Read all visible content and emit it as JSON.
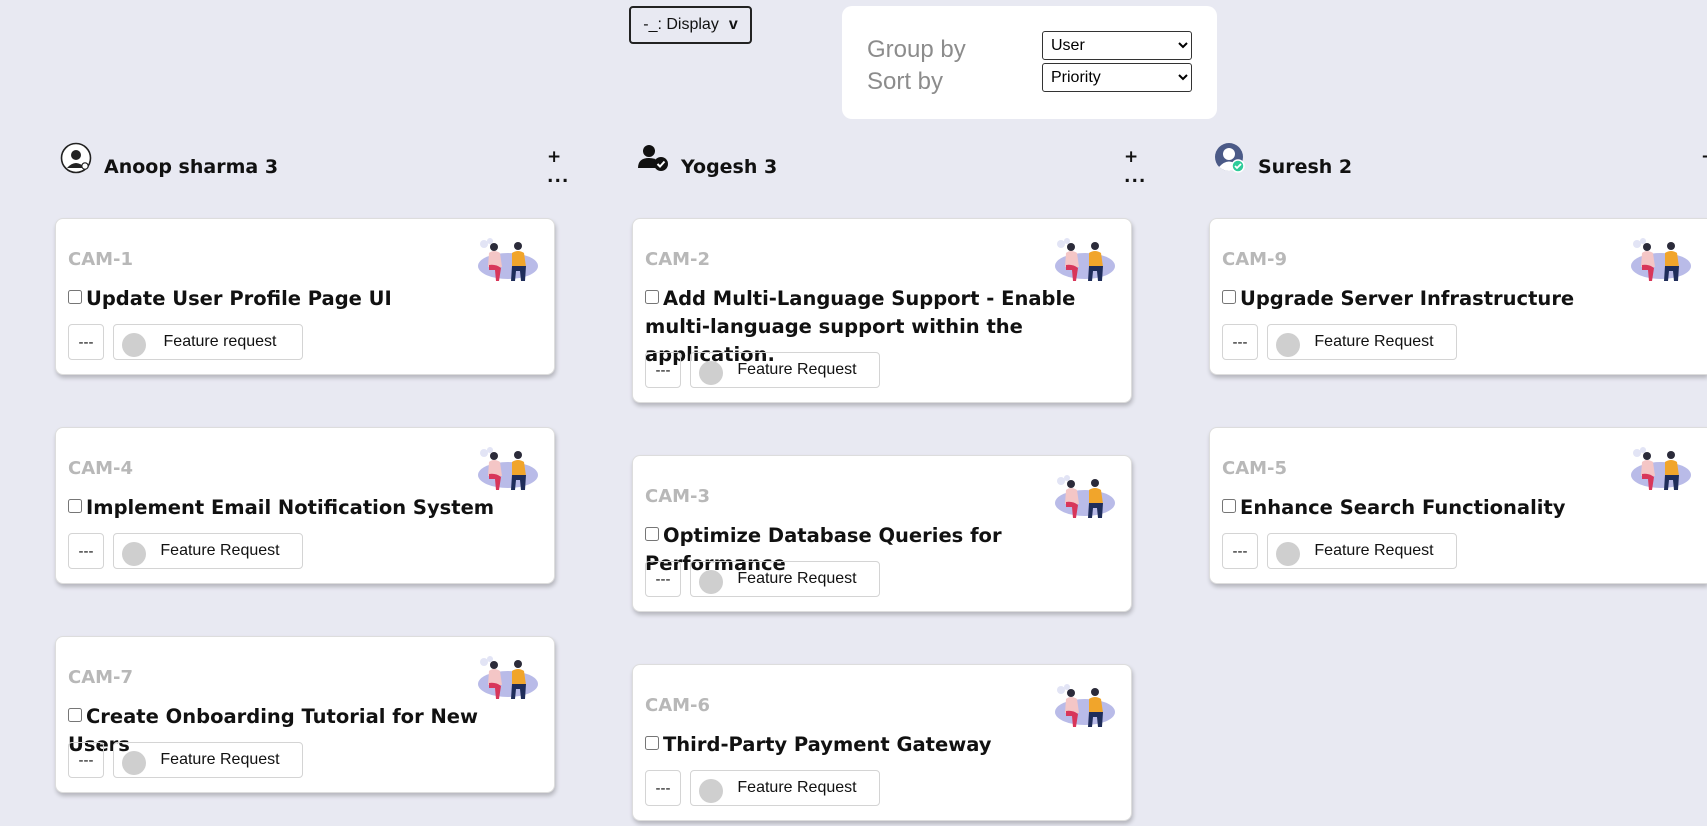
{
  "display_button": {
    "label": "-_: Display",
    "chevron": "v"
  },
  "controls": {
    "group_by_label": "Group by",
    "sort_by_label": "Sort by",
    "group_by_value": "User",
    "sort_by_value": "Priority"
  },
  "columns": [
    {
      "name": "Anoop sharma 3",
      "actions": "+ ...",
      "avatar_icon": "user-circle-icon"
    },
    {
      "name": "Yogesh 3",
      "actions": "+ ...",
      "avatar_icon": "user-check-icon"
    },
    {
      "name": "Suresh 2",
      "actions": "+",
      "avatar_icon": "user-verified-avatar-icon"
    }
  ],
  "cards": [
    {
      "id": "CAM-1",
      "title": "Update User Profile Page UI",
      "priority": "---",
      "tag": "Feature request"
    },
    {
      "id": "CAM-4",
      "title": "Implement Email Notification System",
      "priority": "---",
      "tag": "Feature Request"
    },
    {
      "id": "CAM-7",
      "title": "Create Onboarding Tutorial for New Users",
      "priority": "---",
      "tag": "Feature Request"
    },
    {
      "id": "CAM-2",
      "title": "Add Multi-Language Support - Enable multi-language support within the application.",
      "priority": "---",
      "tag": "Feature Request"
    },
    {
      "id": "CAM-3",
      "title": "Optimize Database Queries for Performance",
      "priority": "---",
      "tag": "Feature Request"
    },
    {
      "id": "CAM-6",
      "title": "Third-Party Payment Gateway",
      "priority": "---",
      "tag": "Feature Request"
    },
    {
      "id": "CAM-9",
      "title": "Upgrade Server Infrastructure",
      "priority": "---",
      "tag": "Feature Request"
    },
    {
      "id": "CAM-5",
      "title": "Enhance Search Functionality",
      "priority": "---",
      "tag": "Feature Request"
    }
  ]
}
